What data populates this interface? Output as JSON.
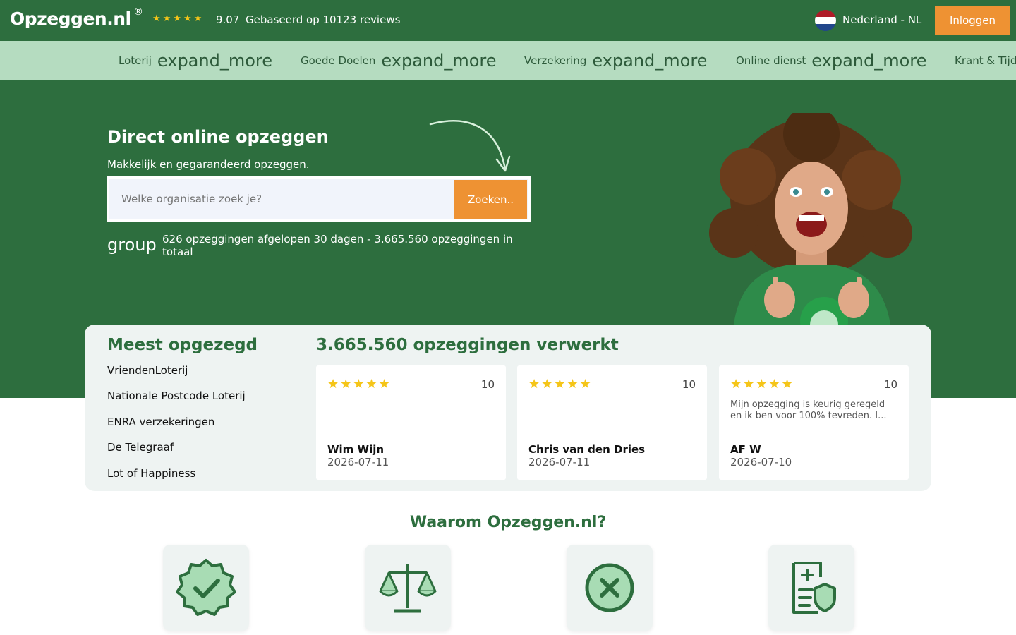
{
  "header": {
    "logo": "Opzeggen.nl",
    "logo_reg": "®",
    "stars": "★★★★★",
    "rating": "9.07",
    "reviews_text": "Gebaseerd op 10123 reviews",
    "country": "Nederland  - NL",
    "login_label": "Inloggen"
  },
  "categories": [
    {
      "label": "Loterij",
      "icon": "expand_more"
    },
    {
      "label": "Goede Doelen",
      "icon": "expand_more"
    },
    {
      "label": "Verzekering",
      "icon": "expand_more"
    },
    {
      "label": "Online dienst",
      "icon": "expand_more"
    },
    {
      "label": "Krant & Tijdschrift",
      "icon": "expand_more"
    }
  ],
  "hero": {
    "title": "Direct online opzeggen",
    "subtitle": "Makkelijk en gegarandeerd opzeggen.",
    "search_placeholder": "Welke organisatie zoek je?",
    "search_button": "Zoeken..",
    "group_icon": "group",
    "stats": "626 opzeggingen afgelopen 30 dagen - 3.665.560 opzeggingen in totaal"
  },
  "most_cancelled": {
    "title": "Meest opgezegd",
    "items": [
      "VriendenLoterij",
      "Nationale Postcode Loterij",
      "ENRA verzekeringen",
      "De Telegraaf",
      "Lot of Happiness"
    ]
  },
  "reviews": {
    "title": "3.665.560 opzeggingen verwerkt",
    "items": [
      {
        "stars": "★★★★★",
        "score": "10",
        "text": "",
        "name": "Wim Wijn",
        "date": "2026-07-11"
      },
      {
        "stars": "★★★★★",
        "score": "10",
        "text": "",
        "name": "Chris van den Dries",
        "date": "2026-07-11"
      },
      {
        "stars": "★★★★★",
        "score": "10",
        "text": "Mijn opzegging is keurig geregeld en ik ben voor 100% tevreden. I...",
        "name": "AF W",
        "date": "2026-07-10"
      }
    ]
  },
  "why": {
    "title": "Waarom Opzeggen.nl?",
    "features": [
      "verified-badge-icon",
      "scale-icon",
      "cancel-circle-icon",
      "document-shield-icon"
    ]
  },
  "colors": {
    "brand_green": "#2d6e3e",
    "light_green": "#b5dcc0",
    "accent_orange": "#ee9233",
    "star_yellow": "#f5c518"
  }
}
